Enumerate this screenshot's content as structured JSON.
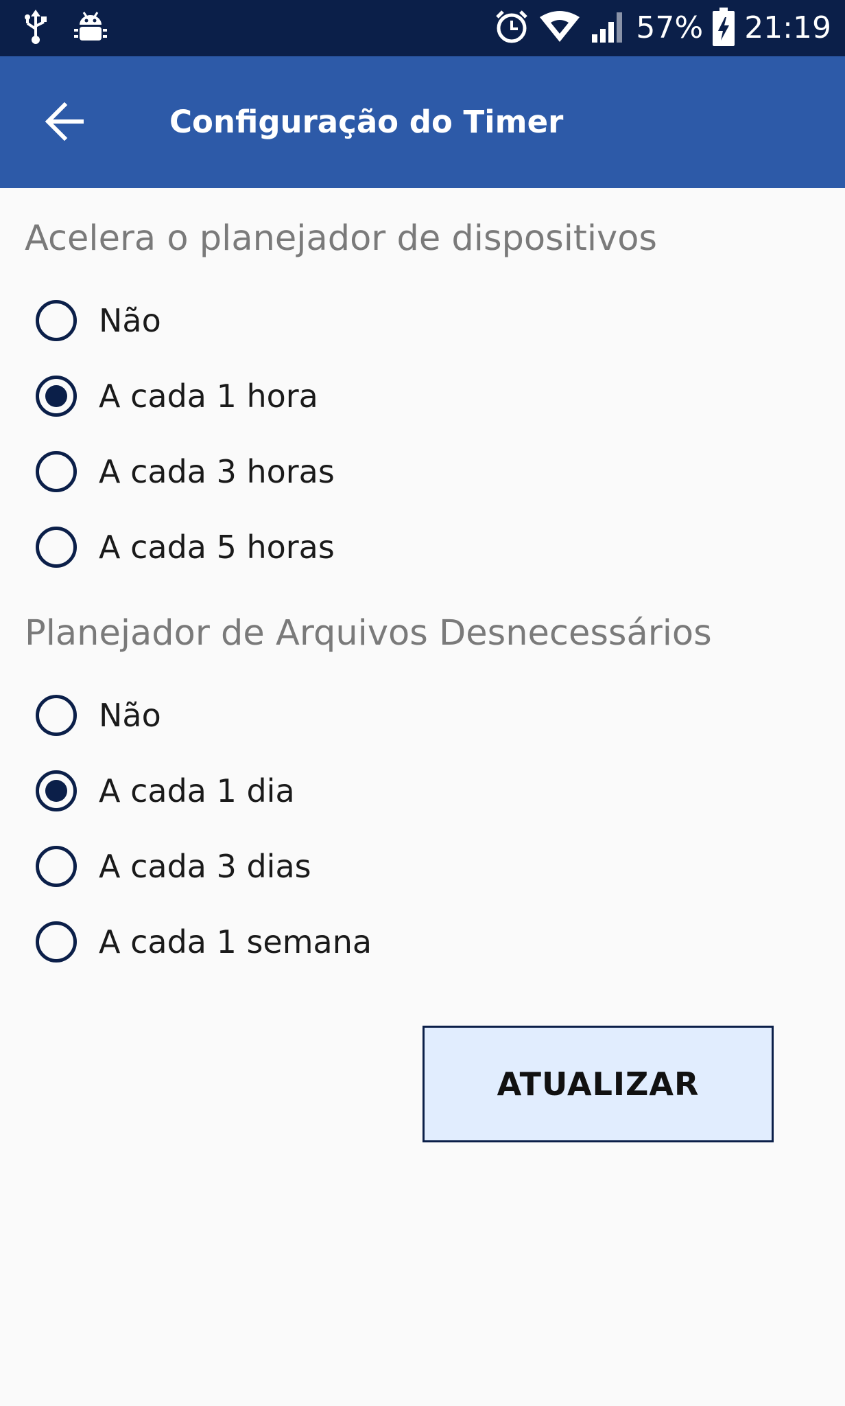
{
  "status_bar": {
    "battery_percent": "57%",
    "time": "21:19",
    "left_icons": [
      "usb-icon",
      "android-debug-icon"
    ],
    "right_icons": [
      "alarm-icon",
      "wifi-icon",
      "signal-icon",
      "battery-charging-icon"
    ]
  },
  "app_bar": {
    "back_icon": "arrow-left-icon",
    "title": "Configuração do Timer",
    "background": "#2d5aa8"
  },
  "sections": [
    {
      "title": "Acelera o planejador de dispositivos",
      "options": [
        {
          "label": "Não",
          "selected": false
        },
        {
          "label": "A cada 1 hora",
          "selected": true
        },
        {
          "label": "A cada 3 horas",
          "selected": false
        },
        {
          "label": "A cada 5 horas",
          "selected": false
        }
      ]
    },
    {
      "title": "Planejador de Arquivos Desnecessários",
      "options": [
        {
          "label": "Não",
          "selected": false
        },
        {
          "label": "A cada 1 dia",
          "selected": true
        },
        {
          "label": "A cada 3 dias",
          "selected": false
        },
        {
          "label": "A cada 1 semana",
          "selected": false
        }
      ]
    }
  ],
  "update_button": {
    "label": "ATUALIZAR"
  },
  "colors": {
    "status_bar": "#0b1f49",
    "accent": "#0b1f49",
    "button_fill": "#e1edfe"
  }
}
